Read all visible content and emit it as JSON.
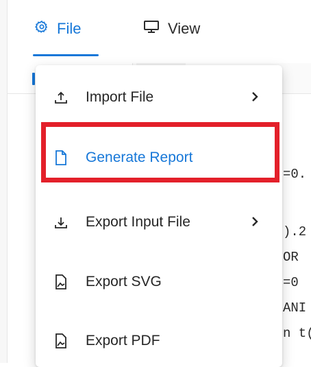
{
  "menubar": {
    "tabs": [
      {
        "label": "File",
        "icon": "gear-icon",
        "active": true
      },
      {
        "label": "View",
        "icon": "monitor-icon",
        "active": false
      }
    ]
  },
  "dropdown": {
    "items": [
      {
        "label": "Import File",
        "icon": "upload-icon",
        "has_submenu": true
      },
      {
        "label": "Generate Report",
        "icon": "document-icon",
        "has_submenu": false,
        "highlighted": true
      },
      {
        "label": "Export Input File",
        "icon": "download-icon",
        "has_submenu": true
      },
      {
        "label": "Export SVG",
        "icon": "image-file-icon",
        "has_submenu": false
      },
      {
        "label": "Export PDF",
        "icon": "image-file-icon",
        "has_submenu": false
      }
    ]
  },
  "code": {
    "lines": [
      "=0.",
      ").2",
      "OR",
      "=0",
      "ANI",
      "n t("
    ]
  },
  "colors": {
    "accent": "#1677d8",
    "highlight": "#e3202a"
  }
}
